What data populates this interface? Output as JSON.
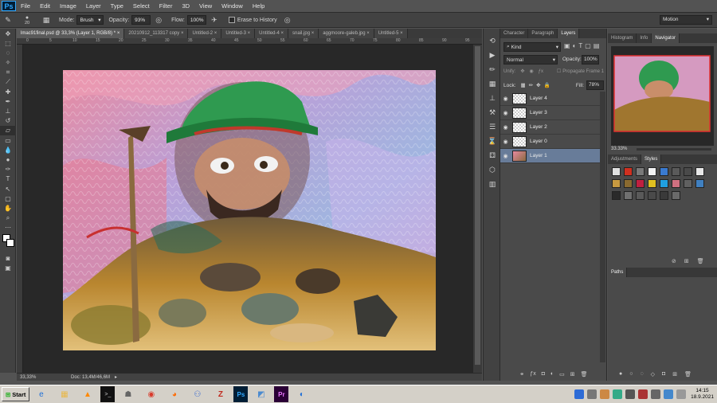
{
  "menu": {
    "logo": "Ps",
    "items": [
      "File",
      "Edit",
      "Image",
      "Layer",
      "Type",
      "Select",
      "Filter",
      "3D",
      "View",
      "Window",
      "Help"
    ]
  },
  "options": {
    "brush_size": "20",
    "mode_label": "Mode:",
    "mode_value": "Brush",
    "opacity_label": "Opacity:",
    "opacity_value": "93%",
    "flow_label": "Flow:",
    "flow_value": "100%",
    "erase_history_label": "Erase to History",
    "workspace": "Motion"
  },
  "doc_tabs": [
    {
      "label": "lmac91final.psd @ 33,3% (Layer 1, RGB/8) *",
      "active": true
    },
    {
      "label": "20210912_113317 copy",
      "active": false
    },
    {
      "label": "Untitled-2",
      "active": false
    },
    {
      "label": "Untitled-3",
      "active": false
    },
    {
      "label": "Untitled-4",
      "active": false
    },
    {
      "label": "snail.jpg",
      "active": false
    },
    {
      "label": "aggmoore-galeb.jpg",
      "active": false
    },
    {
      "label": "Untitled-5",
      "active": false
    }
  ],
  "ruler_ticks": [
    "0",
    "5",
    "10",
    "15",
    "20",
    "25",
    "30",
    "35",
    "40",
    "45",
    "50",
    "55",
    "60",
    "65",
    "70",
    "75",
    "80",
    "85",
    "90",
    "95"
  ],
  "status": {
    "zoom": "33,33%",
    "doc": "Doc: 13,4M/46,6M"
  },
  "layers_panel": {
    "tabs": [
      "Character",
      "Paragraph",
      "Layers"
    ],
    "kind_label": "Kind",
    "blend_mode": "Normal",
    "opacity_label": "Opacity:",
    "opacity_value": "100%",
    "unify_label": "Unify:",
    "propagate_label": "Propagate Frame 1",
    "lock_label": "Lock:",
    "fill_label": "Fill:",
    "fill_value": "78%",
    "layers": [
      {
        "name": "Layer 4",
        "selected": false
      },
      {
        "name": "Layer 3",
        "selected": false
      },
      {
        "name": "Layer 2",
        "selected": false
      },
      {
        "name": "Layer 0",
        "selected": false
      },
      {
        "name": "Layer 1",
        "selected": true
      }
    ]
  },
  "right_panel": {
    "nav_tabs": [
      "Histogram",
      "Info",
      "Navigator"
    ],
    "nav_zoom": "33.33%",
    "style_tabs": [
      "Adjustments",
      "Styles"
    ],
    "paths_tab": "Paths"
  },
  "taskbar": {
    "start": "Start",
    "time": "14:15",
    "date": "18.9.2021"
  },
  "colors": {
    "accent": "#31a8ff",
    "selected_layer": "#687c99",
    "app_bg": "#535353"
  }
}
